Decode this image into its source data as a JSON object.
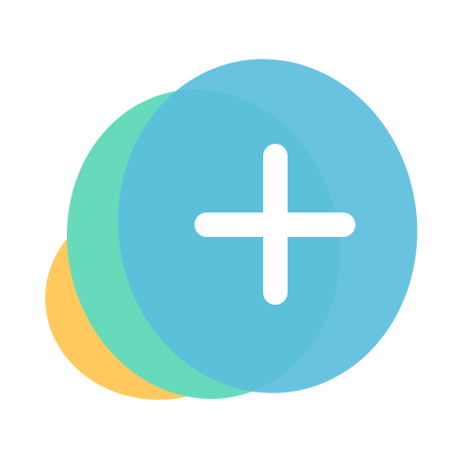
{
  "app_icon": {
    "icon_name": "add-plus-icon",
    "colors": {
      "background": "#ffffff",
      "yellow_blob": "#FFC95E",
      "green_blob": "#67DABC",
      "blue_blob": "#5BBEDD",
      "plus": "#FFFFFF"
    }
  }
}
